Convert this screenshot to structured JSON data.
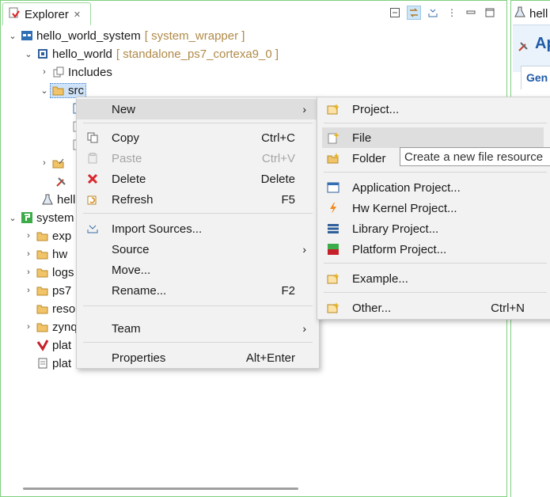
{
  "explorer": {
    "tab_title": "Explorer",
    "tree": [
      {
        "label": "hello_world_system",
        "decoration": "[ system_wrapper ]"
      },
      {
        "label": "hello_world",
        "decoration": "[ standalone_ps7_cortexa9_0 ]"
      },
      {
        "label": "Includes"
      },
      {
        "label": "src"
      },
      {
        "label": "hell"
      },
      {
        "label": "system"
      },
      {
        "label": "exp"
      },
      {
        "label": "hw"
      },
      {
        "label": "logs"
      },
      {
        "label": "ps7"
      },
      {
        "label": "reso"
      },
      {
        "label": "zynq"
      },
      {
        "label": "plat"
      },
      {
        "label": "plat"
      }
    ]
  },
  "right_panel": {
    "tab_title": "hell",
    "header_title": "Ap",
    "section_tab": "Gen"
  },
  "context_menu": {
    "new": "New",
    "copy": "Copy",
    "copy_acc": "Ctrl+C",
    "paste": "Paste",
    "paste_acc": "Ctrl+V",
    "delete": "Delete",
    "delete_acc": "Delete",
    "refresh": "Refresh",
    "refresh_acc": "F5",
    "import_sources": "Import Sources...",
    "source": "Source",
    "move": "Move...",
    "rename": "Rename...",
    "rename_acc": "F2",
    "team": "Team",
    "properties": "Properties",
    "properties_acc": "Alt+Enter"
  },
  "new_submenu": {
    "project": "Project...",
    "file": "File",
    "folder": "Folder",
    "application_project": "Application Project...",
    "hw_kernel_project": "Hw Kernel Project...",
    "library_project": "Library Project...",
    "platform_project": "Platform Project...",
    "example": "Example...",
    "other": "Other...",
    "other_acc": "Ctrl+N"
  },
  "tooltip": "Create a new file resource",
  "colors": {
    "panel_border": "#7fd07f",
    "menu_bg": "#f2f2f2",
    "highlight": "#dedede",
    "decoration": "#b08a48",
    "accent_blue": "#1e5aa8"
  }
}
